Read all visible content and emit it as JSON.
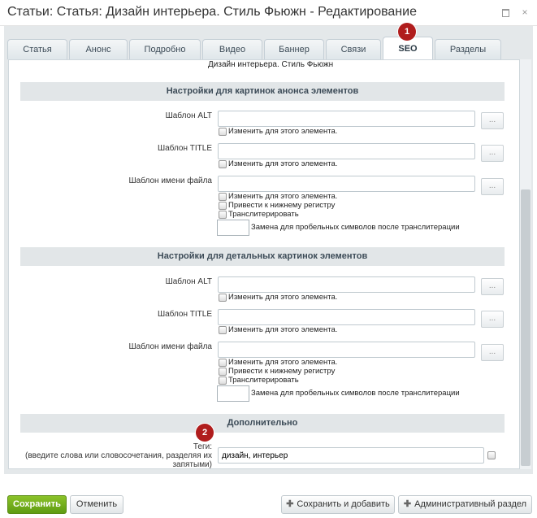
{
  "window": {
    "title": "Статьи: Статья: Дизайн интерьера. Стиль Фьюжн - Редактирование",
    "maximize_icon": "maximize-icon",
    "close_icon": "close-icon",
    "close_glyph": "×"
  },
  "tabs": [
    {
      "label": "Статья",
      "active": false
    },
    {
      "label": "Анонс",
      "active": false
    },
    {
      "label": "Подробно",
      "active": false
    },
    {
      "label": "Видео",
      "active": false
    },
    {
      "label": "Баннер",
      "active": false
    },
    {
      "label": "Связи",
      "active": false
    },
    {
      "label": "SEO",
      "active": true
    },
    {
      "label": "Разделы",
      "active": false
    }
  ],
  "badges": {
    "first": "1",
    "second": "2"
  },
  "element_name": "Дизайн интерьера. Стиль Фьюжн",
  "preview_section": {
    "header": "Настройки для картинок анонса элементов",
    "alt_label": "Шаблон ALT",
    "alt_change": "Изменить для этого элемента.",
    "title_label": "Шаблон TITLE",
    "title_change": "Изменить для этого элемента.",
    "file_label": "Шаблон имени файла",
    "file_change": "Изменить для этого элемента.",
    "lowercase": "Привести к нижнему регистру",
    "translit": "Транслитерировать",
    "space_replace": "Замена для пробельных символов после транслитерации",
    "dots": "..."
  },
  "detail_section": {
    "header": "Настройки для детальных картинок элементов",
    "alt_label": "Шаблон ALT",
    "alt_change": "Изменить для этого элемента.",
    "title_label": "Шаблон TITLE",
    "title_change": "Изменить для этого элемента.",
    "file_label": "Шаблон имени файла",
    "file_change": "Изменить для этого элемента.",
    "lowercase": "Привести к нижнему регистру",
    "translit": "Транслитерировать",
    "space_replace": "Замена для пробельных символов после транслитерации",
    "dots": "..."
  },
  "extra_section": {
    "header": "Дополнительно",
    "tags_label": "Теги:",
    "tags_hint_1": "(введите слова или словосочетания, разделяя их",
    "tags_hint_2": "запятыми)",
    "tags_value": "дизайн, интерьер"
  },
  "buttons": {
    "save": "Сохранить",
    "cancel": "Отменить",
    "save_add": "Сохранить и добавить",
    "admin_section": "Административный раздел",
    "plus": "✚"
  },
  "colors": {
    "accent_green": "#6aa81a",
    "badge_red": "#b01d1d"
  }
}
